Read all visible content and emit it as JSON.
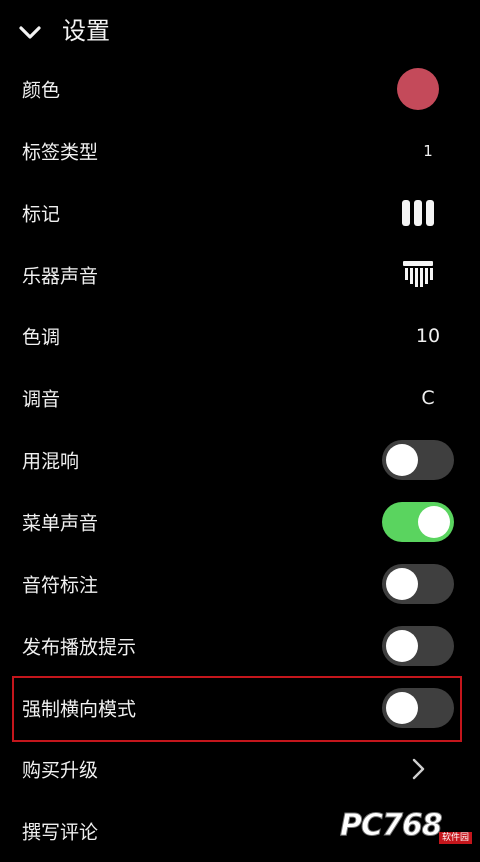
{
  "header": {
    "back_icon": "chevron-down-icon",
    "title": "设置"
  },
  "rows": [
    {
      "label": "颜色",
      "type": "color",
      "color": "#c44a5a"
    },
    {
      "label": "标签类型",
      "type": "value",
      "value": "1"
    },
    {
      "label": "标记",
      "type": "icon",
      "icon": "marker-bars-icon"
    },
    {
      "label": "乐器声音",
      "type": "icon",
      "icon": "kalimba-icon"
    },
    {
      "label": "色调",
      "type": "value",
      "value": "10"
    },
    {
      "label": "调音",
      "type": "value",
      "value": "C"
    },
    {
      "label": "用混响",
      "type": "toggle",
      "on": false
    },
    {
      "label": "菜单声音",
      "type": "toggle",
      "on": true
    },
    {
      "label": "音符标注",
      "type": "toggle",
      "on": false
    },
    {
      "label": "发布播放提示",
      "type": "toggle",
      "on": false
    },
    {
      "label": "强制横向模式",
      "type": "toggle",
      "on": false,
      "highlighted": true
    },
    {
      "label": "购买升级",
      "type": "link",
      "icon": "chevron-right-icon"
    },
    {
      "label": "撰写评论",
      "type": "link"
    }
  ],
  "colors": {
    "background": "#000000",
    "toggle_on": "#5ad45f",
    "toggle_off": "#3f3f3f",
    "highlight_border": "#c4161c"
  },
  "watermark": {
    "text": "PC768",
    "sub": "软件园"
  }
}
